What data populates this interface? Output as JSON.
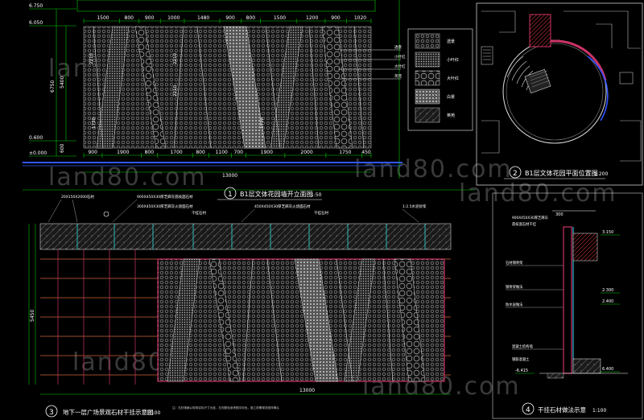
{
  "watermark": "land80.com",
  "elevation1": {
    "caption_num": "1",
    "caption_title": "B1层文体花园墙开立面图",
    "caption_scale": "1:50",
    "top_dims": [
      "1500",
      "800",
      "900",
      "1000",
      "1480",
      "900",
      "800",
      "1500",
      "1200",
      "900",
      "1020"
    ],
    "bottom_dims": [
      "900",
      "1900",
      "800",
      "1700",
      "800",
      "1100",
      "700",
      "1900",
      "2000",
      "1750",
      "450"
    ],
    "total_width": "13000",
    "inner_dims": [
      "2210",
      "2210",
      "2210",
      "1730",
      "1730"
    ],
    "levels": [
      "6.750",
      "6.050",
      "0.600",
      "±0.000"
    ],
    "left_dims": [
      "6750",
      "5400",
      "600"
    ]
  },
  "legend": {
    "items": [
      "透景",
      "小叶红",
      "大叶红",
      "白景",
      "英苑"
    ]
  },
  "plan": {
    "caption_num": "2",
    "caption_title": "B1层文体花园平面位置图",
    "caption_scale": "1:200"
  },
  "elevation3": {
    "caption_num": "3",
    "caption_title": "地下一层广场景观石材干挂示意图",
    "caption_scale": "1:100",
    "callouts": [
      "20X150X2000石材",
      "900X450X30厚芝麻灰荔枝面石材",
      "300X450X30厚芝麻灰火烧面石材",
      "450X450X30厚芝麻灰火烧面石材",
      "干挂石材",
      "干挂石材",
      "1:2.5水泥砂浆"
    ],
    "left_dim": "5450",
    "total_width": "13000",
    "note": "注：石材规格以现场实际尺寸为准，石材颜色参考图中彩色，施工前需现场放样确认"
  },
  "section4": {
    "caption_num": "4",
    "caption_title": "干挂石材做法示意",
    "caption_scale": "1:100",
    "top_dim": "300",
    "callouts": [
      "900X450X30厚芝麻灰",
      "荔枝面石材干挂",
      "石材钢骨架",
      "钢骨架做法",
      "防水层做法",
      "混凝土结构墙",
      "钢筋混凝土"
    ],
    "levels": [
      "3.150",
      "2.300",
      "2.400",
      "6.400",
      "-6.415"
    ]
  }
}
